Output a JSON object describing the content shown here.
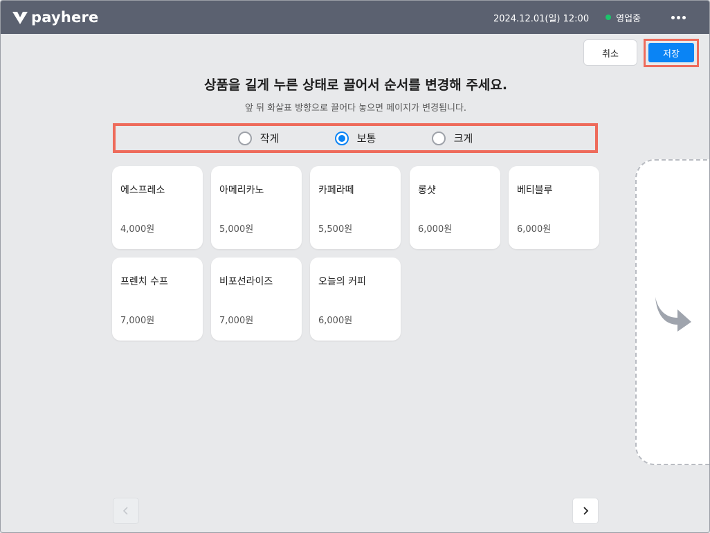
{
  "header": {
    "brand": "payhere",
    "datetime": "2024.12.01(일) 12:00",
    "status": "영업중",
    "status_color": "#1bc46b",
    "more_icon": "more-horizontal-icon"
  },
  "actions": {
    "cancel_label": "취소",
    "save_label": "저장",
    "accent_color": "#0a84f5",
    "highlight_color": "#ee6b5b"
  },
  "instructions": {
    "title": "상품을 길게 누른 상태로 끌어서 순서를 변경해 주세요.",
    "subtitle": "앞 뒤 화살표 방향으로 끌어다 놓으면 페이지가 변경됩니다."
  },
  "size_options": {
    "selected": "보통",
    "items": [
      {
        "label": "작게",
        "selected": false
      },
      {
        "label": "보통",
        "selected": true
      },
      {
        "label": "크게",
        "selected": false
      }
    ]
  },
  "products": [
    {
      "name": "에스프레소",
      "price": "4,000원"
    },
    {
      "name": "아메리카노",
      "price": "5,000원"
    },
    {
      "name": "카페라떼",
      "price": "5,500원"
    },
    {
      "name": "롱샷",
      "price": "6,000원"
    },
    {
      "name": "베티블루",
      "price": "6,000원"
    },
    {
      "name": "프렌치 수프",
      "price": "7,000원"
    },
    {
      "name": "비포선라이즈",
      "price": "7,000원"
    },
    {
      "name": "오늘의 커피",
      "price": "6,000원"
    }
  ],
  "drop_zone": {
    "icon": "curved-arrow-right-icon"
  },
  "pagination": {
    "prev_icon": "chevron-left-icon",
    "next_icon": "chevron-right-icon",
    "prev_disabled": true
  }
}
